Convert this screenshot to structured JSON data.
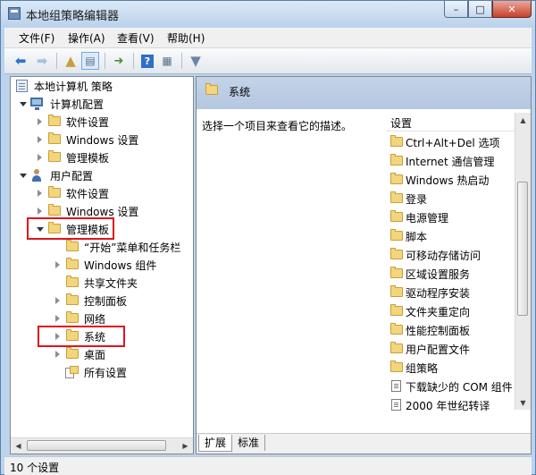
{
  "window": {
    "title": "本地组策略编辑器",
    "buttons": {
      "minimize": "–",
      "maximize": "□",
      "close": "✕"
    }
  },
  "menu": [
    "文件(F)",
    "操作(A)",
    "查看(V)",
    "帮助(H)"
  ],
  "toolbar": {
    "icons": [
      "back-arrow-icon",
      "forward-arrow-icon",
      "up-folder-icon",
      "show-hide-tree-icon",
      "export-list-icon",
      "help-icon",
      "properties-icon",
      "filter-icon"
    ]
  },
  "tree": {
    "root": "本地计算机 策略",
    "computer_config": "计算机配置",
    "cc_software": "软件设置",
    "cc_windows": "Windows 设置",
    "cc_admin": "管理模板",
    "user_config": "用户配置",
    "uc_software": "软件设置",
    "uc_windows": "Windows 设置",
    "uc_admin": "管理模板",
    "uc_admin_children": {
      "start_menu": "“开始”菜单和任务栏",
      "windows_components": "Windows 组件",
      "shared_folders": "共享文件夹",
      "control_panel": "控制面板",
      "network": "网络",
      "system": "系统",
      "desktop": "桌面",
      "all_settings": "所有设置"
    }
  },
  "right_pane": {
    "header_title": "系统",
    "description": "选择一个项目来查看它的描述。",
    "column_header": "设置",
    "items": [
      {
        "label": "Ctrl+Alt+Del 选项",
        "icon": "folder"
      },
      {
        "label": "Internet 通信管理",
        "icon": "folder"
      },
      {
        "label": "Windows 热启动",
        "icon": "folder"
      },
      {
        "label": "登录",
        "icon": "folder"
      },
      {
        "label": "电源管理",
        "icon": "folder"
      },
      {
        "label": "脚本",
        "icon": "folder"
      },
      {
        "label": "可移动存储访问",
        "icon": "folder"
      },
      {
        "label": "区域设置服务",
        "icon": "folder"
      },
      {
        "label": "驱动程序安装",
        "icon": "folder"
      },
      {
        "label": "文件夹重定向",
        "icon": "folder"
      },
      {
        "label": "性能控制面板",
        "icon": "folder"
      },
      {
        "label": "用户配置文件",
        "icon": "folder"
      },
      {
        "label": "组策略",
        "icon": "folder"
      },
      {
        "label": "下载缺少的 COM 组件",
        "icon": "document"
      },
      {
        "label": "2000 年世纪转译",
        "icon": "document"
      }
    ],
    "tabs": [
      "扩展",
      "标准"
    ]
  },
  "status": {
    "text": "10 个设置"
  },
  "colors": {
    "highlight_box": "#e0141c",
    "folder": "#f3d57b"
  }
}
